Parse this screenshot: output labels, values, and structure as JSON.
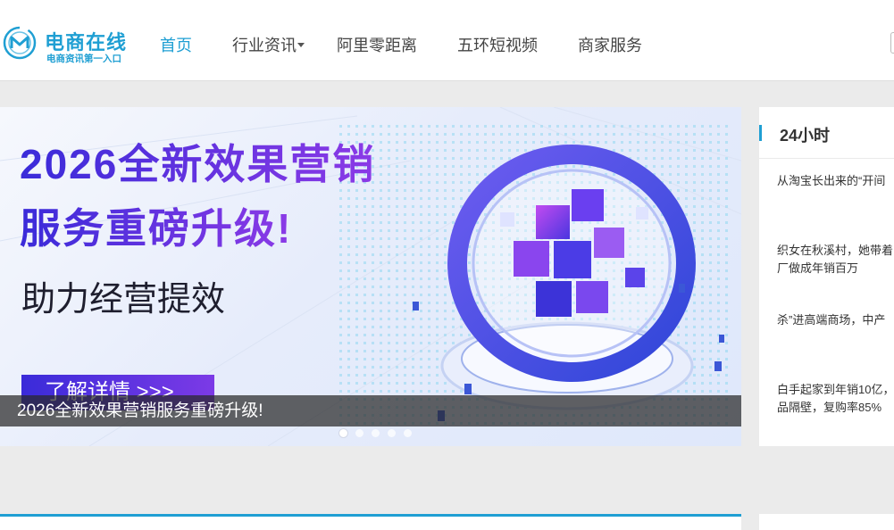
{
  "logo": {
    "title": "电商在线",
    "subtitle": "电商资讯第一入口"
  },
  "nav": [
    {
      "label": "首页",
      "active": true
    },
    {
      "label": "行业资讯",
      "has_dropdown": true
    },
    {
      "label": "阿里零距离"
    },
    {
      "label": "五环短视频"
    },
    {
      "label": "商家服务"
    }
  ],
  "banner": {
    "headline_1": "2026全新效果营销",
    "headline_2": "服务重磅升级!",
    "headline_3": "助力经营提效",
    "cta_label": "了解详情 >>>",
    "caption": "2026全新效果营销服务重磅升级!",
    "slide_count": 5,
    "active_slide": 1
  },
  "sidebar": {
    "title": "24小时",
    "items": [
      {
        "lines": [
          "从淘宝长出来的“开间"
        ]
      },
      {
        "lines": [
          "织女在秋溪村，她带着",
          "厂做成年销百万"
        ]
      },
      {
        "lines": [
          "杀”进高端商场，中产"
        ]
      },
      {
        "lines": [
          "白手起家到年销10亿，",
          "品隔壁，复购率85%"
        ]
      }
    ]
  },
  "colors": {
    "brand": "#1f9fd3",
    "banner_purple": "#5a28d8",
    "page_bg": "#ebebeb"
  },
  "icons": {
    "logo": "ecommerce-m-logo-icon",
    "dropdown": "caret-down-icon"
  }
}
